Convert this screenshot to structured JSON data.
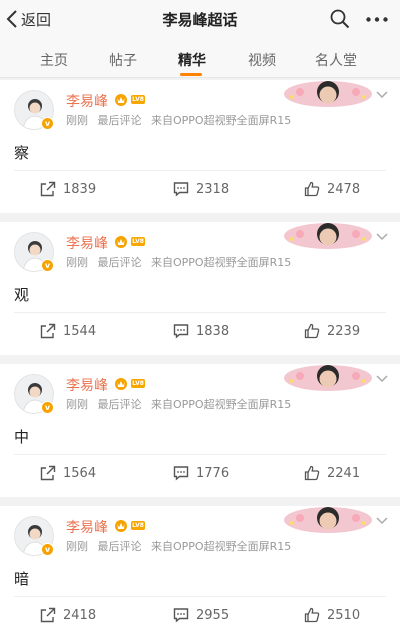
{
  "header": {
    "back_label": "返回",
    "title": "李易峰超话"
  },
  "tabs": [
    {
      "label": "主页"
    },
    {
      "label": "帖子"
    },
    {
      "label": "精华"
    },
    {
      "label": "视频"
    },
    {
      "label": "名人堂"
    }
  ],
  "active_tab": "精华",
  "colors": {
    "accent": "#ff8200",
    "username": "#eb7350",
    "level_badge": "#f8a600",
    "verified_badge": "#f6a300"
  },
  "posts": [
    {
      "username": "李易峰",
      "level": "LV8",
      "time": "刚刚",
      "comment_note": "最后评论",
      "source": "来自OPPO超视野全面屏R15",
      "content": "察",
      "reposts": "1839",
      "comments": "2318",
      "likes": "2478"
    },
    {
      "username": "李易峰",
      "level": "LV8",
      "time": "刚刚",
      "comment_note": "最后评论",
      "source": "来自OPPO超视野全面屏R15",
      "content": "观",
      "reposts": "1544",
      "comments": "1838",
      "likes": "2239"
    },
    {
      "username": "李易峰",
      "level": "LV8",
      "time": "刚刚",
      "comment_note": "最后评论",
      "source": "来自OPPO超视野全面屏R15",
      "content": "中",
      "reposts": "1564",
      "comments": "1776",
      "likes": "2241"
    },
    {
      "username": "李易峰",
      "level": "LV8",
      "time": "刚刚",
      "comment_note": "最后评论",
      "source": "来自OPPO超视野全面屏R15",
      "content": "暗",
      "reposts": "2418",
      "comments": "2955",
      "likes": "2510"
    }
  ]
}
